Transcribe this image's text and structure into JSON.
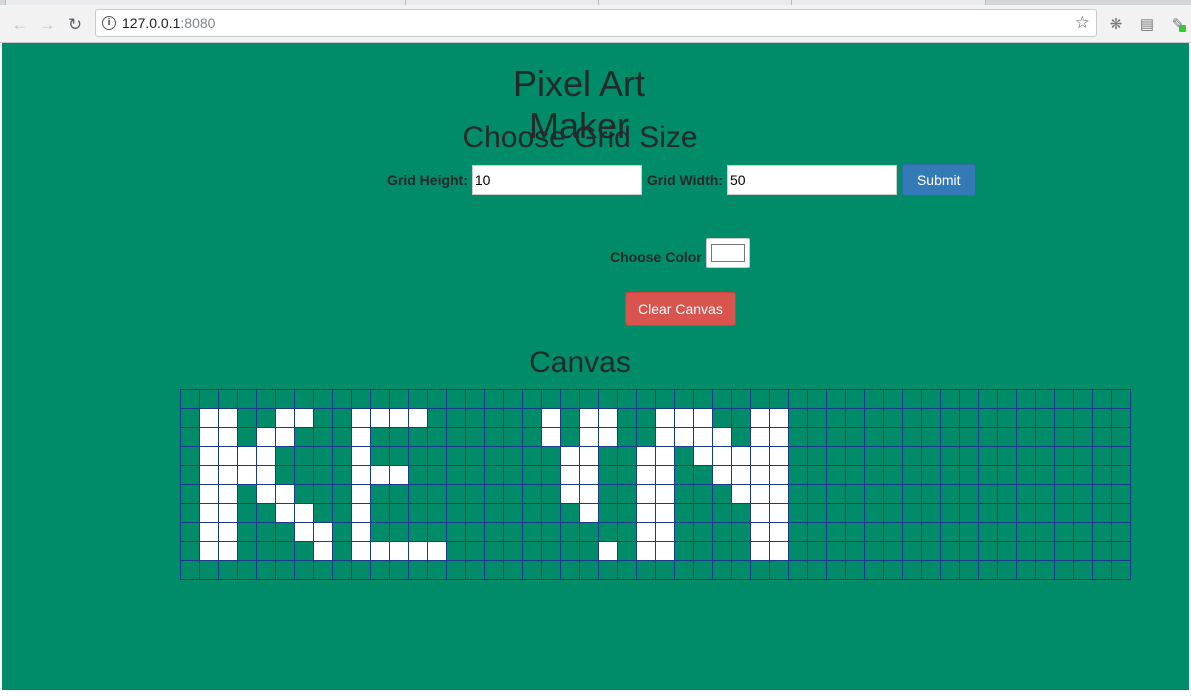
{
  "browser": {
    "url_host": "127.0.0.1",
    "url_port": ":8080",
    "icons": [
      "back-arrow-icon",
      "forward-arrow-icon",
      "reload-icon",
      "info-icon",
      "star-icon",
      "extension-icon",
      "cast-icon",
      "eyedropper-icon"
    ]
  },
  "page": {
    "title": "Pixel Art Maker",
    "grid_size_heading": "Choose Grid Size",
    "grid_height_label": "Grid Height:",
    "grid_height_value": "10",
    "grid_width_label": "Grid Width:",
    "grid_width_value": "50",
    "submit_label": "Submit",
    "choose_color_label": "Choose Color",
    "selected_color": "#ffffff",
    "clear_label": "Clear Canvas",
    "canvas_heading": "Canvas",
    "background_color": "#008b69"
  },
  "canvas": {
    "rows": 10,
    "cols": 50,
    "fill_color": "#ffffff",
    "cells": [
      "00000000000000000000000000000000000000000000000000",
      "01100110011110000001011001110011000000000000000000",
      "01101100010000000001011001111011000000000000000000",
      "01111000010000000000110011011111000000000000000000",
      "01111000011100000000110011001111000000000000000000",
      "01101100010000000000110011000111000000000000000000",
      "01100110010000000000010011000011000000000000000000",
      "01100011010000000000000011000011000000000000000000",
      "01100001011111000000001011000011000000000000000000",
      "00000000000000000000000000000000000000000000000000"
    ]
  }
}
